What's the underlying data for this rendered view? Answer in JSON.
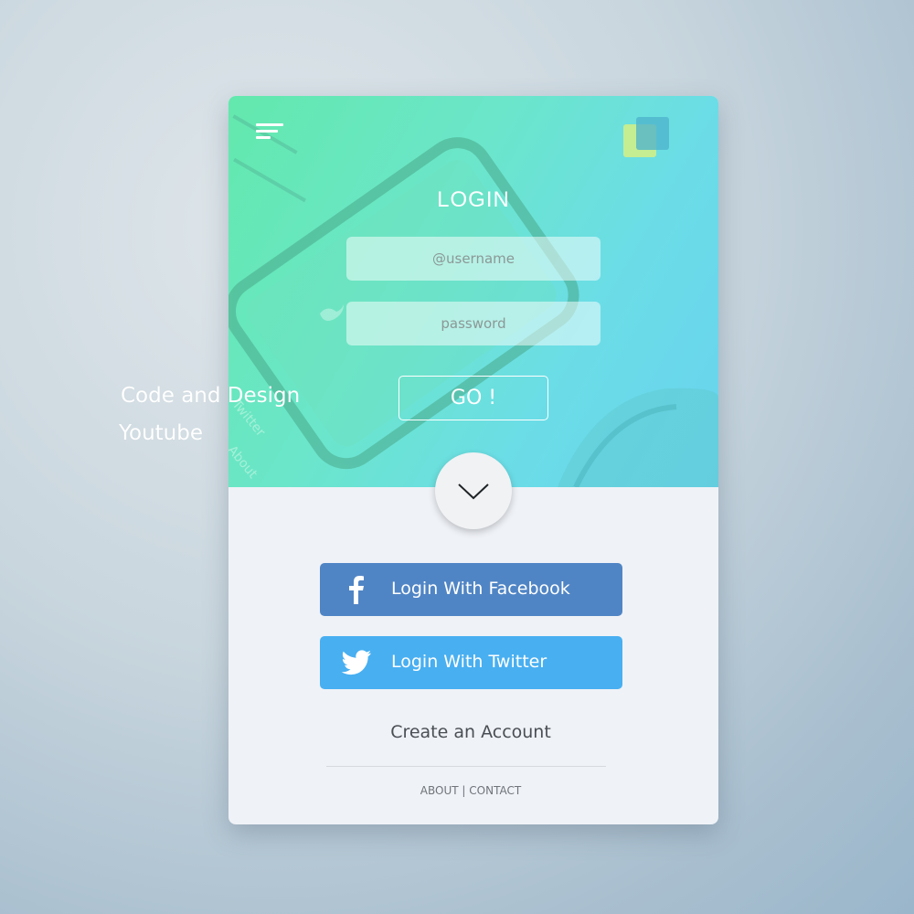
{
  "login": {
    "title": "LOGIN",
    "username_placeholder": "@username",
    "password_placeholder": "password",
    "go_label": "GO !"
  },
  "social": {
    "facebook_label": "Login With Facebook",
    "twitter_label": "Login With Twitter"
  },
  "links": {
    "create_account": "Create an Account",
    "about": "ABOUT",
    "separator": "|",
    "contact": "CONTACT"
  },
  "background_phone": {
    "texts": [
      "Twitter",
      "About"
    ]
  },
  "overlay": {
    "line1": "Code and Design",
    "line2": "Youtube"
  },
  "icons": {
    "menu": "menu-icon",
    "logo": "logo-squares",
    "chevron": "chevron-down-icon",
    "facebook": "facebook-icon",
    "twitter": "twitter-bird-icon"
  },
  "colors": {
    "facebook": "#5085c5",
    "twitter": "#48aff1",
    "hero_start": "#63e8ad",
    "hero_end": "#69d3ef",
    "panel": "#eff2f7"
  }
}
